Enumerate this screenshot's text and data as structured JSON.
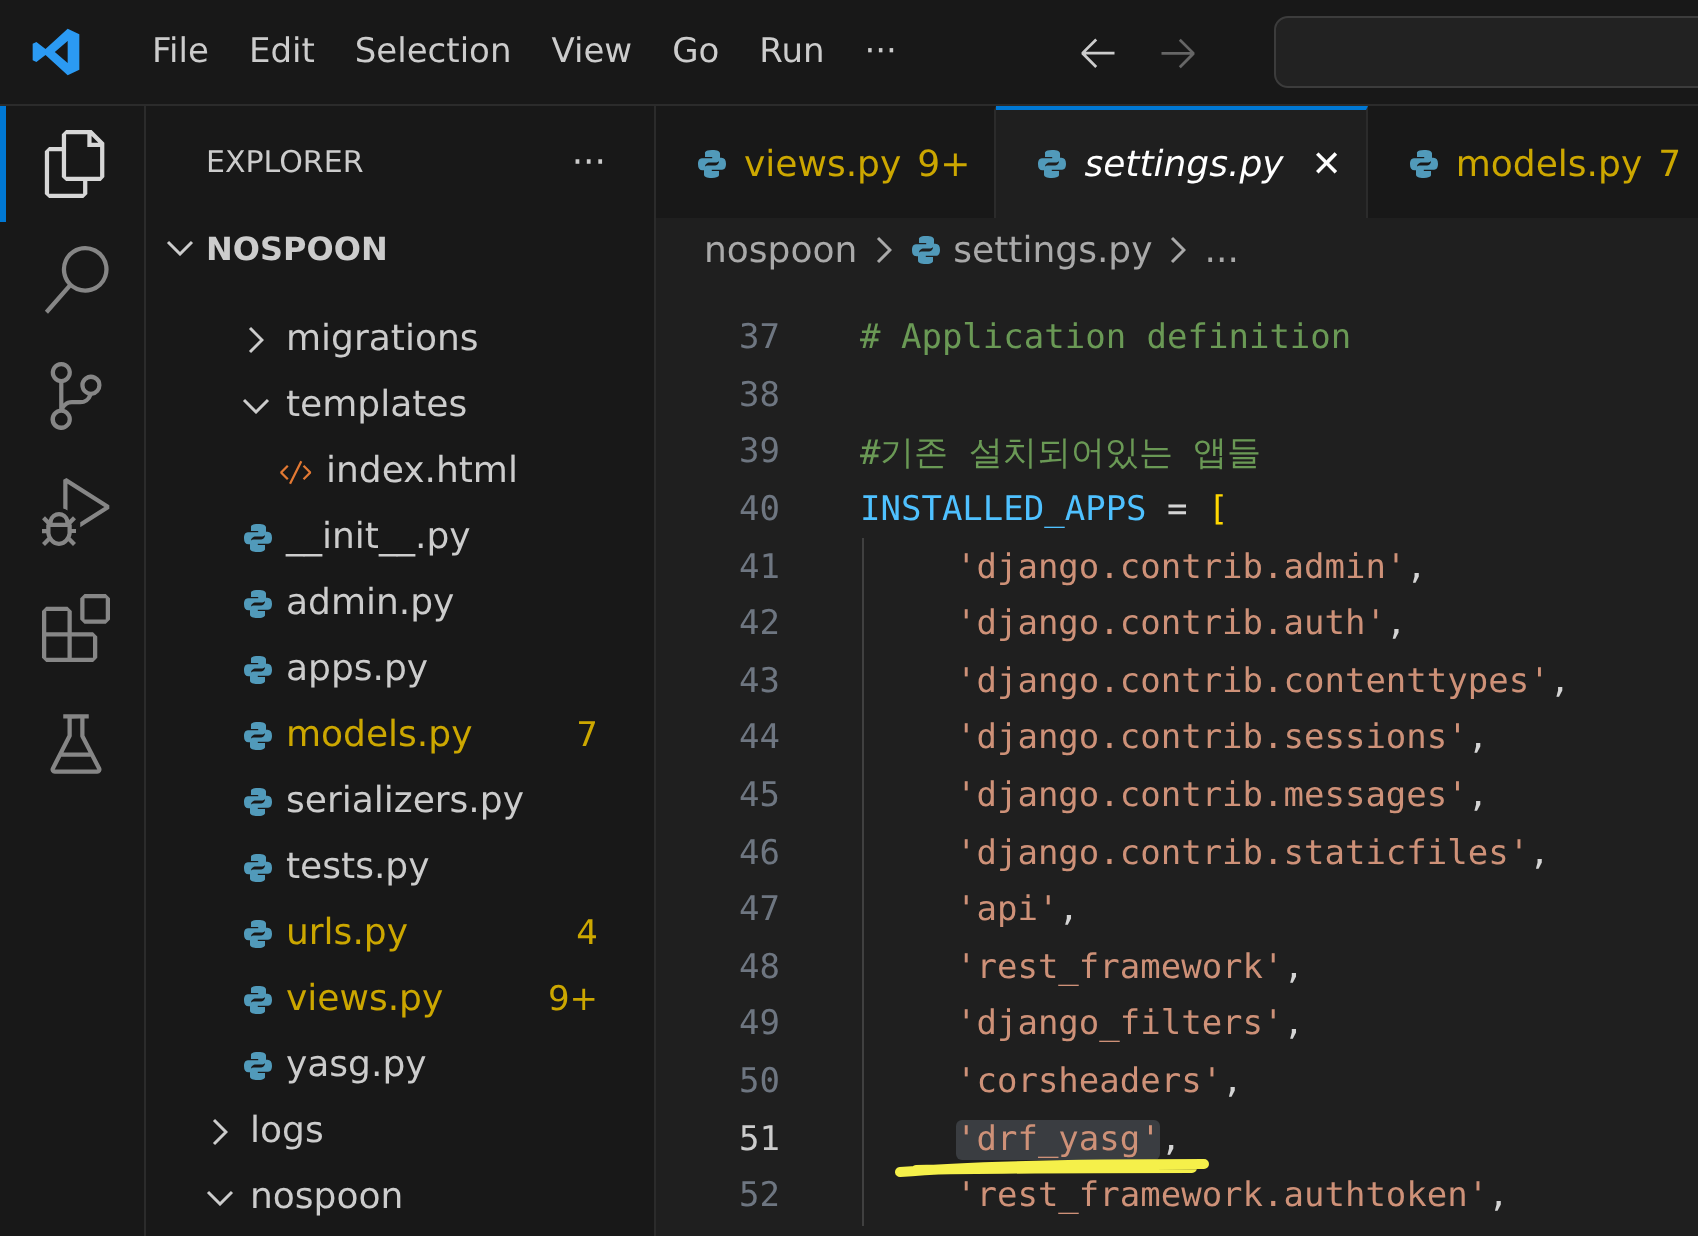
{
  "menu": [
    "File",
    "Edit",
    "Selection",
    "View",
    "Go",
    "Run",
    "···"
  ],
  "activity": [
    {
      "kind": "files",
      "selected": true
    },
    {
      "kind": "search",
      "selected": false
    },
    {
      "kind": "source-control",
      "selected": false
    },
    {
      "kind": "run-debug",
      "selected": false
    },
    {
      "kind": "extensions",
      "selected": false
    },
    {
      "kind": "testing",
      "selected": false
    }
  ],
  "sidebar": {
    "title": "EXPLORER",
    "more": "···",
    "root": {
      "label": "NOSPOON",
      "expanded": true,
      "children": [
        {
          "children": [
            {
              "label": "migrations",
              "kind": "folder",
              "expanded": false
            },
            {
              "label": "templates",
              "kind": "folder",
              "expanded": true,
              "children": [
                {
                  "label": "index.html",
                  "kind": "html"
                }
              ]
            },
            {
              "label": "__init__.py",
              "kind": "python",
              "problems": false
            },
            {
              "label": "admin.py",
              "kind": "python",
              "problems": false
            },
            {
              "label": "apps.py",
              "kind": "python",
              "problems": false
            },
            {
              "label": "models.py",
              "kind": "python",
              "problems": true,
              "badge": "7"
            },
            {
              "label": "serializers.py",
              "kind": "python",
              "problems": false
            },
            {
              "label": "tests.py",
              "kind": "python",
              "problems": false
            },
            {
              "label": "urls.py",
              "kind": "python",
              "problems": true,
              "badge": "4"
            },
            {
              "label": "views.py",
              "kind": "python",
              "problems": true,
              "badge": "9+"
            },
            {
              "label": "yasg.py",
              "kind": "python",
              "problems": false
            }
          ]
        },
        {
          "label": "logs",
          "kind": "folder",
          "expanded": false
        },
        {
          "label": "nospoon",
          "kind": "folder",
          "expanded": true
        }
      ]
    }
  },
  "tabs": [
    {
      "label": "views.py",
      "badge": "9+",
      "problems": true,
      "selected": false,
      "preview": false
    },
    {
      "label": "settings.py",
      "close": "✕",
      "problems": false,
      "selected": true,
      "preview": true
    },
    {
      "label": "models.py",
      "badge": "7",
      "problems": true,
      "selected": false,
      "preview": false
    }
  ],
  "breadcrumb": [
    "nospoon",
    "settings.py",
    "..."
  ],
  "lines": [
    {
      "number": "37",
      "current": false,
      "tokens": [
        {
          "kind": "comment",
          "text": "# Application definition"
        }
      ]
    },
    {
      "number": "38",
      "current": false
    },
    {
      "number": "39",
      "current": false,
      "tokens": [
        {
          "kind": "comment",
          "text": "#기존 설치되어있는 앱들"
        }
      ]
    },
    {
      "number": "40",
      "current": false,
      "tokens": [
        {
          "kind": "variable",
          "text": "INSTALLED_APPS"
        },
        {
          "kind": "plain",
          "text": " = "
        },
        {
          "kind": "bracket",
          "text": "["
        }
      ]
    },
    {
      "number": "41",
      "current": false,
      "indent": true,
      "tokens": [
        {
          "kind": "string",
          "text": "'django.contrib.admin'"
        },
        {
          "kind": "plain",
          "text": ","
        }
      ]
    },
    {
      "number": "42",
      "current": false,
      "indent": true,
      "tokens": [
        {
          "kind": "string",
          "text": "'django.contrib.auth'"
        },
        {
          "kind": "plain",
          "text": ","
        }
      ]
    },
    {
      "number": "43",
      "current": false,
      "indent": true,
      "tokens": [
        {
          "kind": "string",
          "text": "'django.contrib.contenttypes'"
        },
        {
          "kind": "plain",
          "text": ","
        }
      ]
    },
    {
      "number": "44",
      "current": false,
      "indent": true,
      "tokens": [
        {
          "kind": "string",
          "text": "'django.contrib.sessions'"
        },
        {
          "kind": "plain",
          "text": ","
        }
      ]
    },
    {
      "number": "45",
      "current": false,
      "indent": true,
      "tokens": [
        {
          "kind": "string",
          "text": "'django.contrib.messages'"
        },
        {
          "kind": "plain",
          "text": ","
        }
      ]
    },
    {
      "number": "46",
      "current": false,
      "indent": true,
      "tokens": [
        {
          "kind": "string",
          "text": "'django.contrib.staticfiles'"
        },
        {
          "kind": "plain",
          "text": ","
        }
      ]
    },
    {
      "number": "47",
      "current": false,
      "indent": true,
      "tokens": [
        {
          "kind": "string",
          "text": "'api'"
        },
        {
          "kind": "plain",
          "text": ","
        }
      ]
    },
    {
      "number": "48",
      "current": false,
      "indent": true,
      "tokens": [
        {
          "kind": "string",
          "text": "'rest_framework'"
        },
        {
          "kind": "plain",
          "text": ","
        }
      ]
    },
    {
      "number": "49",
      "current": false,
      "indent": true,
      "tokens": [
        {
          "kind": "string",
          "text": "'django_filters'"
        },
        {
          "kind": "plain",
          "text": ","
        }
      ]
    },
    {
      "number": "50",
      "current": false,
      "indent": true,
      "tokens": [
        {
          "kind": "string",
          "text": "'corsheaders'"
        },
        {
          "kind": "plain",
          "text": ","
        }
      ]
    },
    {
      "number": "51",
      "current": true,
      "indent": true,
      "tokens": [
        {
          "kind": "string",
          "text": "'drf_yasg'"
        },
        {
          "kind": "plain",
          "text": ","
        }
      ]
    },
    {
      "number": "52",
      "current": false,
      "indent": true,
      "tokens": [
        {
          "kind": "string",
          "text": "'rest_framework.authtoken'"
        },
        {
          "kind": "plain",
          "text": ","
        }
      ]
    }
  ]
}
